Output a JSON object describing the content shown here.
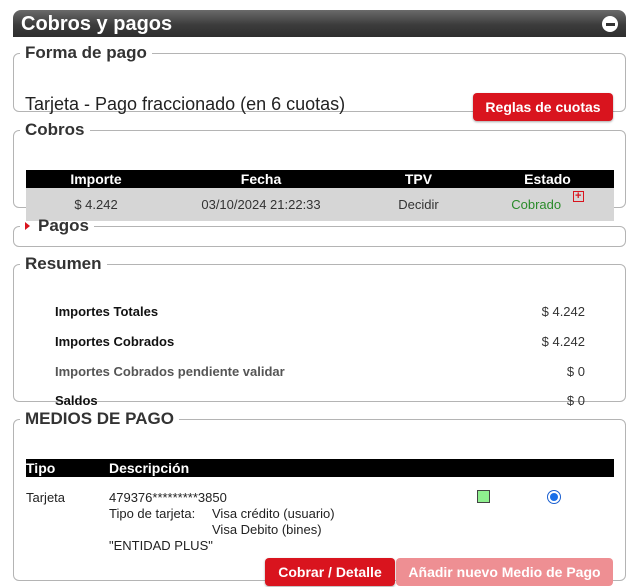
{
  "header": {
    "title": "Cobros y pagos"
  },
  "forma_pago": {
    "legend": "Forma de pago",
    "text": "Tarjeta - Pago fraccionado (en 6 cuotas)",
    "reglas_button": "Reglas de cuotas"
  },
  "cobros": {
    "legend": "Cobros",
    "columns": [
      "Importe",
      "Fecha",
      "TPV",
      "Estado"
    ],
    "rows": [
      {
        "importe": "$ 4.242",
        "fecha": "03/10/2024 21:22:33",
        "tpv": "Decidir",
        "estado": "Cobrado"
      }
    ],
    "estado_color": "#2a8b2a"
  },
  "pagos": {
    "legend": "Pagos"
  },
  "resumen": {
    "legend": "Resumen",
    "rows": [
      {
        "label": "Importes Totales",
        "value": "$ 4.242"
      },
      {
        "label": "Importes Cobrados",
        "value": "$ 4.242"
      },
      {
        "label": "Importes Cobrados pendiente validar",
        "value": "$ 0"
      },
      {
        "label": "Saldos",
        "value": "$ 0"
      }
    ]
  },
  "medios": {
    "legend": "MEDIOS DE PAGO",
    "columns": [
      "Tipo",
      "Descripción"
    ],
    "row": {
      "tipo": "Tarjeta",
      "numero": "479376*********3850",
      "tipo_tarjeta_label": "Tipo de tarjeta:",
      "tipo_tarjeta_1": "Visa crédito (usuario)",
      "tipo_tarjeta_2": "Visa Debito (bines)",
      "entidad": "\"ENTIDAD PLUS\""
    },
    "cobrar_button": "Cobrar / Detalle",
    "anadir_button": "Añadir nuevo Medio de Pago"
  },
  "colors": {
    "brand_red": "#d9141e",
    "disabled_red": "#ee8f93"
  }
}
